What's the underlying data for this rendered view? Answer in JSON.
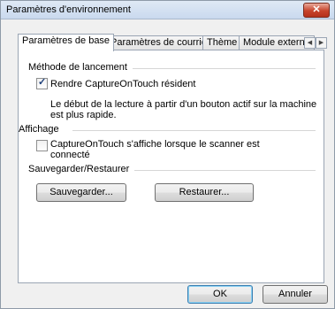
{
  "window": {
    "title": "Paramètres d'environnement",
    "close_symbol": "✕"
  },
  "tabs": [
    {
      "label": "Paramètres de base"
    },
    {
      "label": "Paramètres de courriel"
    },
    {
      "label": "Thème"
    },
    {
      "label": "Module externe"
    }
  ],
  "tab_scroll": {
    "left": "◀",
    "right": "▶"
  },
  "launch": {
    "group_label": "Méthode de lancement",
    "checkbox": {
      "checked": true,
      "label": "Rendre CaptureOnTouch résident"
    },
    "description_line1": "Le début de la lecture à partir d'un bouton actif sur la machine",
    "description_line2": "est plus rapide."
  },
  "display": {
    "group_label": "Affichage",
    "checkbox": {
      "checked": false,
      "label_line1": "CaptureOnTouch s'affiche lorsque le scanner est",
      "label_line2": "connecté"
    }
  },
  "backup": {
    "group_label": "Sauvegarder/Restaurer",
    "save_label": "Sauvegarder...",
    "restore_label": "Restaurer..."
  },
  "footer": {
    "ok_label": "OK",
    "cancel_label": "Annuler"
  }
}
